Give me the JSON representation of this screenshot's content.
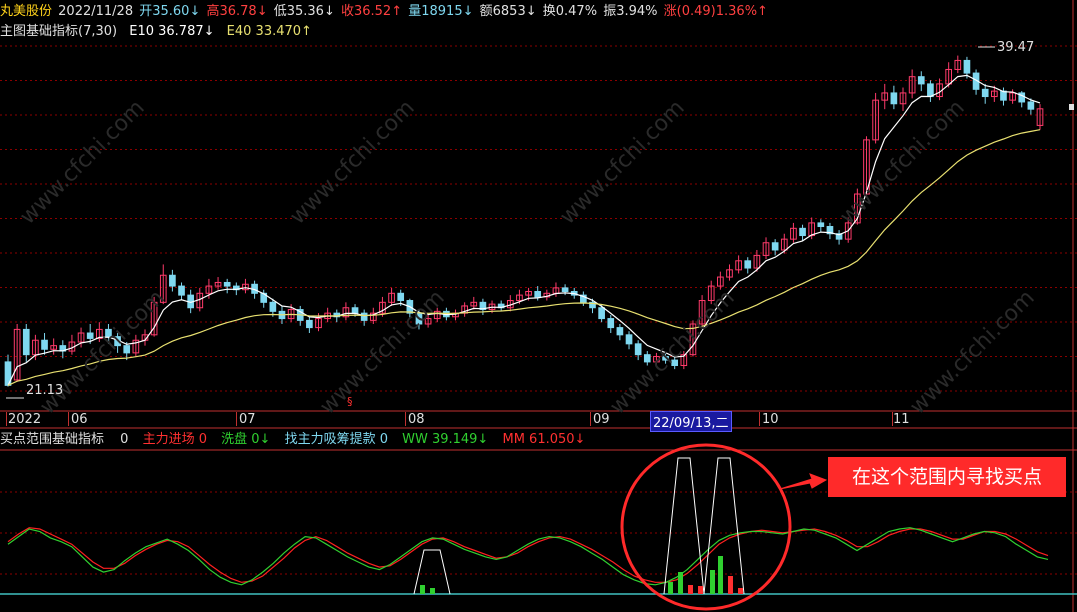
{
  "stock": {
    "name": "丸美股份",
    "date": "2022/11/28",
    "open": "开35.60↓",
    "high": "高36.78↓",
    "low": "低35.36↓",
    "close": "收36.52↑",
    "volume": "量18915↓",
    "amount": "额6853↓",
    "turnover": "换0.47%",
    "amplitude": "振3.94%",
    "change": "涨(0.49)1.36%↑"
  },
  "main_indicator": {
    "name": "主图基础指标(7,30)",
    "e10": "E10 36.787↓",
    "e40": "E40 33.470↑"
  },
  "price_labels": {
    "high": "39.47",
    "low": "21.13"
  },
  "month_axis": [
    "2022",
    "06",
    "07",
    "08",
    "09",
    "22/09/13,二",
    "10",
    "11"
  ],
  "marker": "§",
  "sub_indicator": {
    "name": "买点范围基础指标",
    "zero": "0",
    "zljc": "主力进场 0",
    "xp": "洗盘 0↓",
    "zzl": "找主力吸筹提款 0",
    "ww": "WW 39.149↓",
    "mm": "MM 61.050↓"
  },
  "callout": "在这个范围内寻找买点",
  "watermark": "www.cfchi.com",
  "colors": {
    "up": "#ff3b6b",
    "down": "#7fd8f0",
    "e10": "#ffffff",
    "e40": "#e8e070",
    "grid": "#8b0000",
    "ww": "#30d030",
    "mm": "#ff2020"
  },
  "chart_data": {
    "type": "candlestick",
    "price_axis": {
      "min": 20.5,
      "max": 40.0
    },
    "candles": [
      [
        22.5,
        21.2,
        22.9,
        21.13
      ],
      [
        21.5,
        24.3,
        24.6,
        21.4
      ],
      [
        24.3,
        22.9,
        24.6,
        22.5
      ],
      [
        22.9,
        23.7,
        24.0,
        22.6
      ],
      [
        23.7,
        23.2,
        24.1,
        22.9
      ],
      [
        23.2,
        23.4,
        23.8,
        22.9
      ],
      [
        23.4,
        23.1,
        23.7,
        22.7
      ],
      [
        23.1,
        23.6,
        24.0,
        22.9
      ],
      [
        23.6,
        24.1,
        24.4,
        23.3
      ],
      [
        24.1,
        23.8,
        24.6,
        23.5
      ],
      [
        23.8,
        24.3,
        24.7,
        23.6
      ],
      [
        24.3,
        23.9,
        24.6,
        23.5
      ],
      [
        23.9,
        23.4,
        24.1,
        23.0
      ],
      [
        23.4,
        23.0,
        23.6,
        22.6
      ],
      [
        23.0,
        23.7,
        24.0,
        22.8
      ],
      [
        23.7,
        24.0,
        24.3,
        23.4
      ],
      [
        24.0,
        25.8,
        26.1,
        23.9
      ],
      [
        25.8,
        27.3,
        27.9,
        25.7
      ],
      [
        27.3,
        26.7,
        27.6,
        26.4
      ],
      [
        26.7,
        26.2,
        26.9,
        25.9
      ],
      [
        26.2,
        25.5,
        26.5,
        25.2
      ],
      [
        25.5,
        26.3,
        26.6,
        25.3
      ],
      [
        26.3,
        26.7,
        27.1,
        26.0
      ],
      [
        26.7,
        26.9,
        27.2,
        26.5
      ],
      [
        26.9,
        26.7,
        27.1,
        26.3
      ],
      [
        26.7,
        26.5,
        26.9,
        26.2
      ],
      [
        26.5,
        26.8,
        27.1,
        26.3
      ],
      [
        26.8,
        26.3,
        27.0,
        26.0
      ],
      [
        26.3,
        25.8,
        26.5,
        25.5
      ],
      [
        25.8,
        25.3,
        26.0,
        25.0
      ],
      [
        25.3,
        24.9,
        25.6,
        24.6
      ],
      [
        24.9,
        25.4,
        25.7,
        24.7
      ],
      [
        25.4,
        24.8,
        25.6,
        24.5
      ],
      [
        24.8,
        24.4,
        25.0,
        24.1
      ],
      [
        24.4,
        24.9,
        25.2,
        24.2
      ],
      [
        24.9,
        25.2,
        25.5,
        24.7
      ],
      [
        25.2,
        25.0,
        25.4,
        24.7
      ],
      [
        25.0,
        25.5,
        25.8,
        24.8
      ],
      [
        25.5,
        25.2,
        25.7,
        25.0
      ],
      [
        25.2,
        24.8,
        25.4,
        24.5
      ],
      [
        24.8,
        25.2,
        25.5,
        24.6
      ],
      [
        25.2,
        25.8,
        26.1,
        25.0
      ],
      [
        25.8,
        26.3,
        26.6,
        25.6
      ],
      [
        26.3,
        25.9,
        26.5,
        25.6
      ],
      [
        25.9,
        25.2,
        26.0,
        24.9
      ],
      [
        25.2,
        24.6,
        25.4,
        24.3
      ],
      [
        24.6,
        24.9,
        25.1,
        24.4
      ],
      [
        24.9,
        25.3,
        25.5,
        24.7
      ],
      [
        25.3,
        25.0,
        25.5,
        24.8
      ],
      [
        25.0,
        25.2,
        25.4,
        24.8
      ],
      [
        25.2,
        25.6,
        25.8,
        25.0
      ],
      [
        25.6,
        25.8,
        26.1,
        25.4
      ],
      [
        25.8,
        25.4,
        26.0,
        25.1
      ],
      [
        25.4,
        25.7,
        25.9,
        25.2
      ],
      [
        25.7,
        25.5,
        25.9,
        25.3
      ],
      [
        25.5,
        25.9,
        26.2,
        25.3
      ],
      [
        25.9,
        26.2,
        26.5,
        25.7
      ],
      [
        26.2,
        26.4,
        26.6,
        25.9
      ],
      [
        26.4,
        26.1,
        26.7,
        25.9
      ],
      [
        26.1,
        26.3,
        26.5,
        25.9
      ],
      [
        26.3,
        26.6,
        26.9,
        26.1
      ],
      [
        26.6,
        26.4,
        26.8,
        26.2
      ],
      [
        26.4,
        26.2,
        26.6,
        26.0
      ],
      [
        26.2,
        25.8,
        26.4,
        25.6
      ],
      [
        25.8,
        25.5,
        26.0,
        25.2
      ],
      [
        25.5,
        24.9,
        25.7,
        24.7
      ],
      [
        24.9,
        24.4,
        25.1,
        24.1
      ],
      [
        24.4,
        24.0,
        24.6,
        23.7
      ],
      [
        24.0,
        23.5,
        24.2,
        23.2
      ],
      [
        23.5,
        22.9,
        23.7,
        22.6
      ],
      [
        22.9,
        22.5,
        23.1,
        22.3
      ],
      [
        22.5,
        22.8,
        23.0,
        22.3
      ],
      [
        22.8,
        22.6,
        23.0,
        22.4
      ],
      [
        22.6,
        22.3,
        22.8,
        22.1
      ],
      [
        22.3,
        22.9,
        23.1,
        22.1
      ],
      [
        22.9,
        24.6,
        24.8,
        22.8
      ],
      [
        24.6,
        25.9,
        26.2,
        24.5
      ],
      [
        25.9,
        26.7,
        27.0,
        25.7
      ],
      [
        26.7,
        27.2,
        27.5,
        26.5
      ],
      [
        27.2,
        27.6,
        27.9,
        27.0
      ],
      [
        27.6,
        28.1,
        28.4,
        27.4
      ],
      [
        28.1,
        27.7,
        28.3,
        27.4
      ],
      [
        27.7,
        28.4,
        28.7,
        27.5
      ],
      [
        28.4,
        29.1,
        29.4,
        28.2
      ],
      [
        29.1,
        28.7,
        29.3,
        28.4
      ],
      [
        28.7,
        29.3,
        29.6,
        28.5
      ],
      [
        29.3,
        29.9,
        30.2,
        29.1
      ],
      [
        29.9,
        29.5,
        30.1,
        29.2
      ],
      [
        29.5,
        30.2,
        30.5,
        29.3
      ],
      [
        30.2,
        30.0,
        30.4,
        29.7
      ],
      [
        30.0,
        29.6,
        30.2,
        29.3
      ],
      [
        29.6,
        29.3,
        29.8,
        29.0
      ],
      [
        29.3,
        30.2,
        30.5,
        29.1
      ],
      [
        30.2,
        31.8,
        32.1,
        30.1
      ],
      [
        31.8,
        34.8,
        35.0,
        31.7
      ],
      [
        34.8,
        37.0,
        37.4,
        34.6
      ],
      [
        37.0,
        37.4,
        37.9,
        36.5
      ],
      [
        37.4,
        36.8,
        37.8,
        36.5
      ],
      [
        36.8,
        37.4,
        37.7,
        36.4
      ],
      [
        37.4,
        38.3,
        38.7,
        37.1
      ],
      [
        38.3,
        37.9,
        38.6,
        37.5
      ],
      [
        37.9,
        37.2,
        38.1,
        36.9
      ],
      [
        37.2,
        37.9,
        38.2,
        37.0
      ],
      [
        37.9,
        38.7,
        39.1,
        37.7
      ],
      [
        38.7,
        39.2,
        39.47,
        38.5
      ],
      [
        39.2,
        38.5,
        39.4,
        38.2
      ],
      [
        38.5,
        37.6,
        38.7,
        37.3
      ],
      [
        37.6,
        37.2,
        37.9,
        36.8
      ],
      [
        37.2,
        37.5,
        37.8,
        36.9
      ],
      [
        37.5,
        37.0,
        37.7,
        36.7
      ],
      [
        37.0,
        37.4,
        37.6,
        36.8
      ],
      [
        37.4,
        36.9,
        37.5,
        36.6
      ],
      [
        36.9,
        36.5,
        37.1,
        36.2
      ],
      [
        35.6,
        36.52,
        36.78,
        35.36
      ]
    ],
    "ww_series": [
      40,
      46,
      52,
      50,
      45,
      42,
      38,
      30,
      22,
      18,
      20,
      27,
      33,
      38,
      41,
      44,
      40,
      35,
      28,
      20,
      14,
      10,
      8,
      12,
      18,
      25,
      33,
      40,
      46,
      45,
      40,
      35,
      30,
      26,
      22,
      20,
      24,
      30,
      36,
      42,
      45,
      44,
      40,
      36,
      33,
      30,
      28,
      30,
      35,
      40,
      44,
      46,
      45,
      42,
      38,
      33,
      28,
      22,
      16,
      12,
      9,
      8,
      10,
      14,
      20,
      28,
      36,
      43,
      47,
      49,
      50,
      50,
      49,
      48,
      50,
      52,
      51,
      48,
      45,
      40,
      35,
      40,
      45,
      50,
      52,
      53,
      51,
      48,
      45,
      42,
      45,
      48,
      50,
      49,
      46,
      40,
      35,
      30,
      28
    ],
    "mm_series": [
      42,
      48,
      53,
      52,
      48,
      44,
      40,
      33,
      26,
      21,
      21,
      25,
      31,
      36,
      40,
      43,
      42,
      38,
      31,
      24,
      18,
      13,
      10,
      11,
      15,
      22,
      29,
      37,
      43,
      46,
      43,
      38,
      33,
      29,
      25,
      22,
      23,
      28,
      34,
      40,
      44,
      45,
      42,
      38,
      35,
      32,
      29,
      30,
      33,
      38,
      42,
      45,
      46,
      44,
      40,
      36,
      31,
      26,
      20,
      15,
      12,
      10,
      10,
      12,
      17,
      24,
      32,
      40,
      45,
      48,
      50,
      51,
      50,
      49,
      50,
      51,
      52,
      50,
      47,
      43,
      38,
      38,
      42,
      47,
      50,
      52,
      52,
      50,
      47,
      44,
      44,
      47,
      50,
      50,
      48,
      44,
      39,
      34,
      31
    ]
  }
}
